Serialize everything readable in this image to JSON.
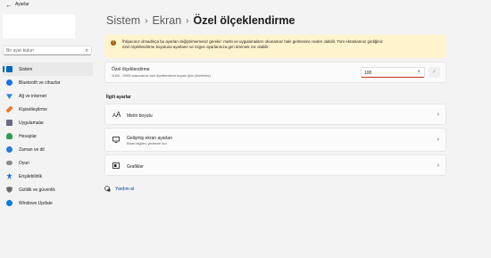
{
  "window": {
    "title": "Ayarlar"
  },
  "sidebar": {
    "search_placeholder": "Bir ayar bulun",
    "items": [
      {
        "label": "Sistem",
        "icon": "system-icon",
        "color": "#0067c0",
        "active": true
      },
      {
        "label": "Bluetooth ve cihazlar",
        "icon": "bluetooth-icon",
        "color": "#1a73e8"
      },
      {
        "label": "Ağ ve internet",
        "icon": "network-icon",
        "color": "#2a84d6"
      },
      {
        "label": "Kişiselleştirme",
        "icon": "personalization-icon",
        "color": "#e8772e"
      },
      {
        "label": "Uygulamalar",
        "icon": "apps-icon",
        "color": "#6b6b8a"
      },
      {
        "label": "Hesaplar",
        "icon": "accounts-icon",
        "color": "#2f9e55"
      },
      {
        "label": "Zaman ve dil",
        "icon": "time-language-icon",
        "color": "#2a7bd6"
      },
      {
        "label": "Oyun",
        "icon": "gaming-icon",
        "color": "#8a8a8a"
      },
      {
        "label": "Erişilebilirlik",
        "icon": "accessibility-icon",
        "color": "#1f6fd1"
      },
      {
        "label": "Gizlilik ve güvenlik",
        "icon": "privacy-shield-icon",
        "color": "#6d6d6d"
      },
      {
        "label": "Windows Update",
        "icon": "windows-update-icon",
        "color": "#0a7ad6"
      }
    ]
  },
  "header": {
    "crumb1": "Sistem",
    "crumb2": "Ekran",
    "current": "Özel ölçeklendirme"
  },
  "warning": {
    "line1": "İhtiyacınız olmadıkça bu ayarları değiştirmemeniz gerekir: metin ve uygulamaların okunamaz hale gelmesine neden olabilir. Tüm ekranlarınız girdiğiniz",
    "line2": "özel ölçeklendirme boyutuna ayarlanır ve özgün ayarlarınıza geri dönmek zor olabilir."
  },
  "custom_scale": {
    "title": "Özel ölçeklendirme",
    "subtitle": "%100 - %500 arasında bir özel ölçeklendirme boyutu girin (önerilmez)",
    "value": "100",
    "clear_glyph": "×",
    "apply_glyph": "✓"
  },
  "related": {
    "heading": "İlgili ayarlar",
    "items": [
      {
        "title": "Metin boyutu",
        "subtitle": "",
        "icon": "text-size-icon"
      },
      {
        "title": "Gelişmiş ekran ayarları",
        "subtitle": "Ekran bilgileri, yenileme hızı",
        "icon": "monitor-icon"
      },
      {
        "title": "Grafikler",
        "subtitle": "",
        "icon": "graphics-icon"
      }
    ]
  },
  "help": {
    "label": "Yardım al"
  }
}
